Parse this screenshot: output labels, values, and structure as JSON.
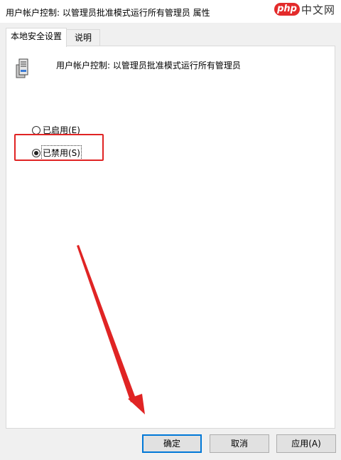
{
  "window": {
    "title": "用户帐户控制: 以管理员批准模式运行所有管理员 属性",
    "close_glyph": "✕"
  },
  "watermark": {
    "logo": "php",
    "text": "中文网"
  },
  "tabs": [
    {
      "label": "本地安全设置",
      "active": true
    },
    {
      "label": "说明",
      "active": false
    }
  ],
  "policy": {
    "name": "用户帐户控制: 以管理员批准模式运行所有管理员",
    "icon": "server-policy-icon"
  },
  "options": [
    {
      "label": "已启用(E)",
      "checked": false
    },
    {
      "label": "已禁用(S)",
      "checked": true
    }
  ],
  "buttons": {
    "ok": "确定",
    "cancel": "取消",
    "apply": "应用(A)"
  },
  "colors": {
    "highlight": "#e02424",
    "default_button_border": "#0078d7"
  }
}
